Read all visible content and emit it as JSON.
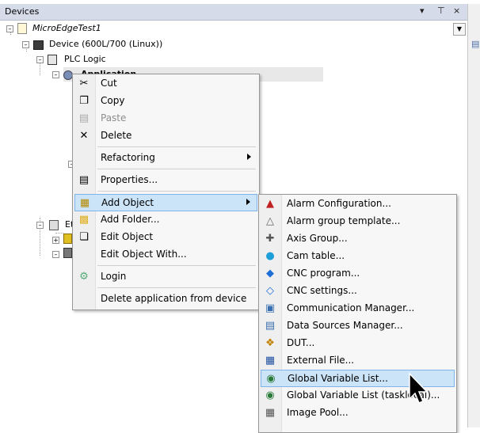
{
  "panel": {
    "title": "Devices",
    "pin_glyph": "↓",
    "float_glyph": "¤",
    "close_glyph": "×"
  },
  "tree": {
    "project": "MicroEdgeTest1",
    "device": "Device (600L/700 (Linux))",
    "plc_logic": "PLC Logic",
    "application": "Application",
    "ethercat_prefix": "Et"
  },
  "context_menu": {
    "items": [
      {
        "label": "Cut",
        "icon": "scissors-icon"
      },
      {
        "label": "Copy",
        "icon": "copy-icon"
      },
      {
        "label": "Paste",
        "icon": "paste-icon",
        "disabled": true
      },
      {
        "label": "Delete",
        "icon": "delete-icon"
      },
      {
        "label": "Refactoring",
        "submenu": true
      },
      {
        "label": "Properties...",
        "icon": "properties-icon"
      },
      {
        "label": "Add Object",
        "icon": "add-object-icon",
        "submenu": true,
        "highlighted": true
      },
      {
        "label": "Add Folder...",
        "icon": "folder-icon"
      },
      {
        "label": "Edit Object",
        "icon": "edit-object-icon"
      },
      {
        "label": "Edit Object With..."
      },
      {
        "label": "Login",
        "icon": "login-icon"
      },
      {
        "label": "Delete application from device"
      }
    ]
  },
  "submenu": {
    "items": [
      {
        "label": "Alarm Configuration...",
        "icon": "alarm-configuration-icon"
      },
      {
        "label": "Alarm group template...",
        "icon": "alarm-group-icon"
      },
      {
        "label": "Axis Group...",
        "icon": "axis-group-icon"
      },
      {
        "label": "Cam table...",
        "icon": "cam-table-icon"
      },
      {
        "label": "CNC program...",
        "icon": "cnc-program-icon"
      },
      {
        "label": "CNC settings...",
        "icon": "cnc-settings-icon"
      },
      {
        "label": "Communication Manager...",
        "icon": "communication-manager-icon"
      },
      {
        "label": "Data Sources Manager...",
        "icon": "data-sources-icon"
      },
      {
        "label": "DUT...",
        "icon": "dut-icon"
      },
      {
        "label": "External File...",
        "icon": "external-file-icon"
      },
      {
        "label": "Global Variable List...",
        "icon": "globe-icon",
        "highlighted": true
      },
      {
        "label": "Global Variable List (tasklocal)...",
        "icon": "gvl-tasklocal-icon"
      },
      {
        "label": "Image Pool...",
        "icon": "image-pool-icon"
      }
    ]
  },
  "colors": {
    "highlight": "#cce4f7",
    "highlight_border": "#7eb4ea",
    "header": "#d6dbe9"
  }
}
